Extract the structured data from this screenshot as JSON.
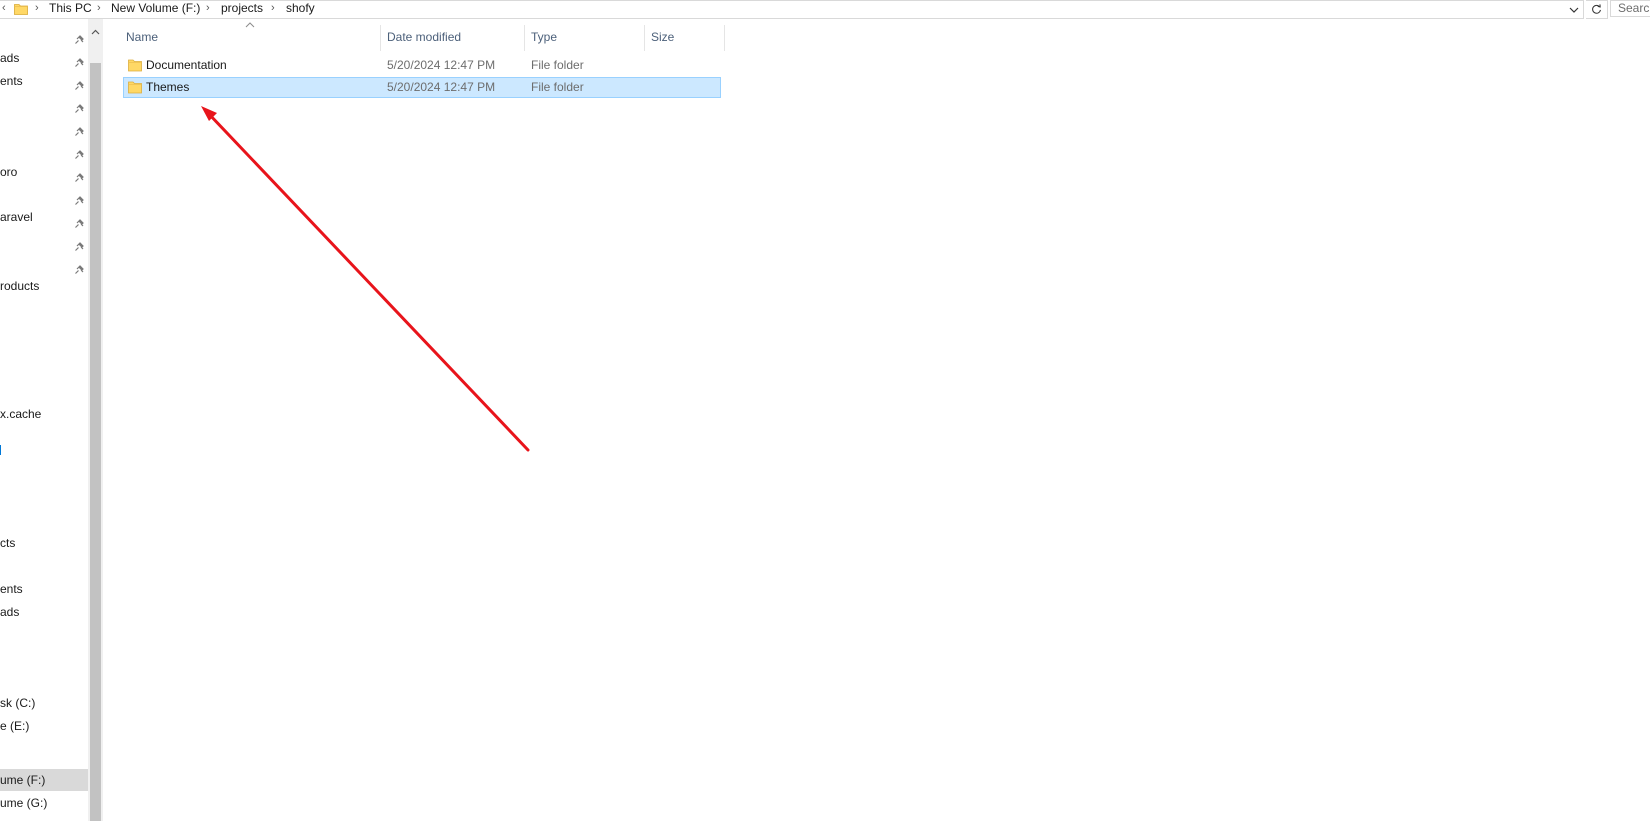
{
  "address_bar": {
    "breadcrumbs": [
      "This PC",
      "New Volume (F:)",
      "projects",
      "shofy"
    ],
    "search_placeholder": "Search"
  },
  "nav_pane": {
    "items": [
      {
        "label": "ads",
        "pinned": true
      },
      {
        "label": "ents",
        "pinned": true
      },
      {
        "label": "",
        "pinned": true
      },
      {
        "label": "",
        "pinned": true
      },
      {
        "label": "",
        "pinned": true
      },
      {
        "label": "oro",
        "pinned": true
      },
      {
        "label": "",
        "pinned": true
      },
      {
        "label": "aravel",
        "pinned": true
      },
      {
        "label": "",
        "pinned": true
      },
      {
        "label": "",
        "pinned": true
      },
      {
        "label": "roducts",
        "pinned": false
      },
      {
        "label": "x.cache",
        "pinned": false
      },
      {
        "label": "cts",
        "pinned": false
      },
      {
        "label": "ents",
        "pinned": false
      },
      {
        "label": "ads",
        "pinned": false
      },
      {
        "label": "sk (C:)",
        "pinned": false
      },
      {
        "label": "e (E:)",
        "pinned": false
      },
      {
        "label": "ume (F:)",
        "pinned": false,
        "selected": true
      },
      {
        "label": "ume (G:)",
        "pinned": false
      }
    ]
  },
  "file_list": {
    "columns": {
      "name": "Name",
      "date_modified": "Date modified",
      "type": "Type",
      "size": "Size"
    },
    "rows": [
      {
        "name": "Documentation",
        "date_modified": "5/20/2024 12:47 PM",
        "type": "File folder",
        "size": "",
        "selected": false
      },
      {
        "name": "Themes",
        "date_modified": "5/20/2024 12:47 PM",
        "type": "File folder",
        "size": "",
        "selected": true
      }
    ]
  },
  "colors": {
    "selection_fill": "#cce8ff",
    "selection_border": "#99d1ff",
    "folder_yellow": "#ffd866",
    "annotation_arrow": "#e8141b",
    "header_text": "#4c607a"
  },
  "icons": {
    "breadcrumb_folder": "folder-icon",
    "pin": "pin-icon",
    "refresh": "refresh-icon",
    "dropdown": "chevron-down-icon"
  }
}
